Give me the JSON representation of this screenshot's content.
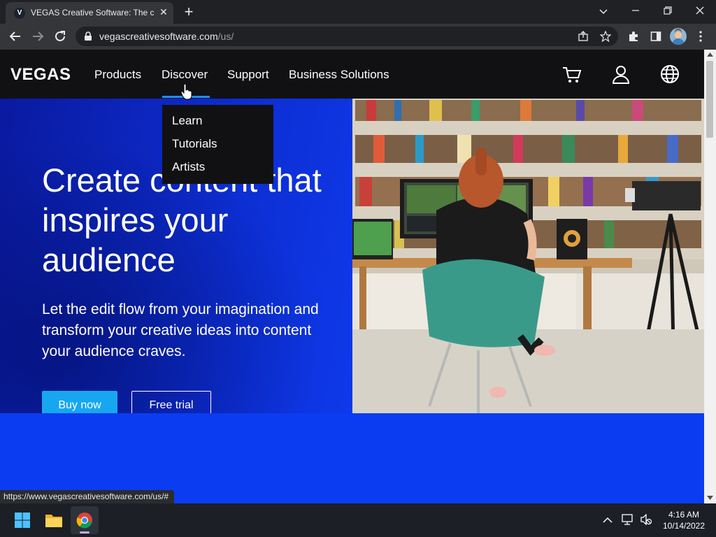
{
  "browser": {
    "tab_title": "VEGAS Creative Software: The cc",
    "tab_favicon_letter": "V",
    "url_domain": "vegascreativesoftware.com",
    "url_path": "/us/",
    "status_url": "https://www.vegascreativesoftware.com/us/#"
  },
  "site": {
    "logo": "VEGAS",
    "nav": [
      "Products",
      "Discover",
      "Support",
      "Business Solutions"
    ],
    "dropdown": [
      "Learn",
      "Tutorials",
      "Artists"
    ],
    "hero": {
      "title": "Create content that inspires your audience",
      "subtitle": "Let the edit flow from your imagination and transform your creative ideas into content your audience craves.",
      "buy_label": "Buy now",
      "trial_label": "Free trial"
    },
    "colors": {
      "nav_bg": "#111114",
      "hero_blue": "#0e3cf0",
      "buy_button": "#16a7f0",
      "accent_underline": "#1e90ff"
    },
    "icons": [
      "cart-icon",
      "account-icon",
      "globe-icon"
    ]
  },
  "taskbar": {
    "time": "4:16 AM",
    "date": "10/14/2022"
  }
}
